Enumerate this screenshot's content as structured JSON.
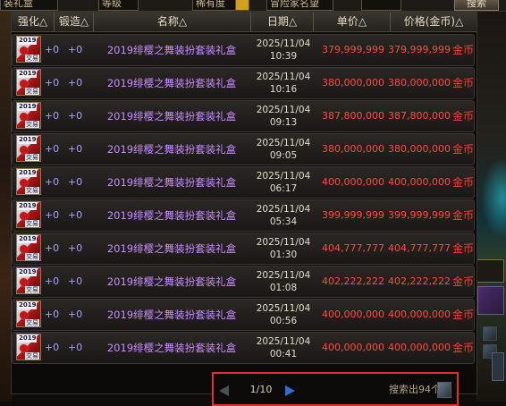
{
  "top": {
    "field_1": "装礼盒",
    "field_2": "等级",
    "field_3": "稀有度",
    "field_4": "冒险家名望",
    "search_button": "搜索"
  },
  "headers": {
    "strengthen": "强化△",
    "forge": "锻造△",
    "name": "名称△",
    "date": "日期△",
    "unit_price": "单价△",
    "price": "价格(金币)△"
  },
  "item_icon": {
    "year": "2019",
    "trade": "交易",
    "icon": "gift-box-icon"
  },
  "rows": [
    {
      "str": "+0",
      "frg": "+0",
      "name": "2019绯樱之舞装扮套装礼盒",
      "date": "2025/11/04",
      "time": "10:39",
      "unit": "379,999,999",
      "price": "379,999,999",
      "currency": "金币"
    },
    {
      "str": "+0",
      "frg": "+0",
      "name": "2019绯樱之舞装扮套装礼盒",
      "date": "2025/11/04",
      "time": "10:16",
      "unit": "380,000,000",
      "price": "380,000,000",
      "currency": "金币"
    },
    {
      "str": "+0",
      "frg": "+0",
      "name": "2019绯樱之舞装扮套装礼盒",
      "date": "2025/11/04",
      "time": "09:13",
      "unit": "387,800,000",
      "price": "387,800,000",
      "currency": "金币"
    },
    {
      "str": "+0",
      "frg": "+0",
      "name": "2019绯樱之舞装扮套装礼盒",
      "date": "2025/11/04",
      "time": "09:05",
      "unit": "380,000,000",
      "price": "380,000,000",
      "currency": "金币"
    },
    {
      "str": "+0",
      "frg": "+0",
      "name": "2019绯樱之舞装扮套装礼盒",
      "date": "2025/11/04",
      "time": "06:17",
      "unit": "400,000,000",
      "price": "400,000,000",
      "currency": "金币"
    },
    {
      "str": "+0",
      "frg": "+0",
      "name": "2019绯樱之舞装扮套装礼盒",
      "date": "2025/11/04",
      "time": "05:34",
      "unit": "399,999,999",
      "price": "399,999,999",
      "currency": "金币"
    },
    {
      "str": "+0",
      "frg": "+0",
      "name": "2019绯樱之舞装扮套装礼盒",
      "date": "2025/11/04",
      "time": "01:30",
      "unit": "404,777,777",
      "price": "404,777,777",
      "currency": "金币"
    },
    {
      "str": "+0",
      "frg": "+0",
      "name": "2019绯樱之舞装扮套装礼盒",
      "date": "2025/11/04",
      "time": "01:08",
      "unit": "402,222,222",
      "price": "402,222,222",
      "currency": "金币"
    },
    {
      "str": "+0",
      "frg": "+0",
      "name": "2019绯樱之舞装扮套装礼盒",
      "date": "2025/11/04",
      "time": "00:56",
      "unit": "400,000,000",
      "price": "400,000,000",
      "currency": "金币"
    },
    {
      "str": "+0",
      "frg": "+0",
      "name": "2019绯樱之舞装扮套装礼盒",
      "date": "2025/11/04",
      "time": "00:41",
      "unit": "400,000,000",
      "price": "400,000,000",
      "currency": "金币"
    }
  ],
  "pagination": {
    "page": "1/10",
    "result": "搜索出94个"
  },
  "colors": {
    "accent_red": "#ff4a44",
    "name_purple": "#c88cff",
    "highlight_border": "#e03030"
  }
}
